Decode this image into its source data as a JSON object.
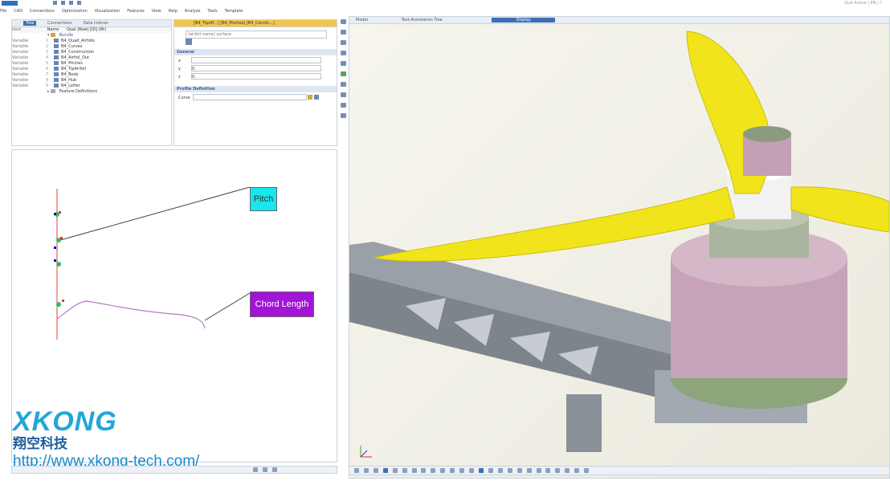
{
  "window": {
    "title_right": "Quit Active | EN | ?"
  },
  "menu": [
    "File",
    "CAD",
    "Connections",
    "Optimization",
    "Visualization",
    "Features",
    "View",
    "Help",
    "Analyze",
    "Tools",
    "Template"
  ],
  "left_tabs": [
    "Tree",
    "Connections",
    "Data Indices"
  ],
  "tree": {
    "header_cols": [
      "Item",
      "Name",
      "Qual (Row) [ID] (Rt)"
    ],
    "root": "Bundle",
    "items": [
      {
        "type": "Variable",
        "num": "1",
        "label": "B4_Quad_Airfoils"
      },
      {
        "type": "Variable",
        "num": "2",
        "label": "B4_Curves"
      },
      {
        "type": "Variable",
        "num": "3",
        "label": "B4_Construction"
      },
      {
        "type": "Variable",
        "num": "4",
        "label": "B4_Airfoil_Out"
      },
      {
        "type": "Variable",
        "num": "5",
        "label": "B4_Pitches"
      },
      {
        "type": "Variable",
        "num": "6",
        "label": "B4_TipAirfoil"
      },
      {
        "type": "Variable",
        "num": "7",
        "label": "B4_Body"
      },
      {
        "type": "Variable",
        "num": "8",
        "label": "B4_Hub"
      },
      {
        "type": "Variable",
        "num": "9",
        "label": "B4_Lofter"
      }
    ],
    "footer_item": "Feature Definitions"
  },
  "props": {
    "tab_title": "[B4_Tipoff...]   [B4_Pitches]   [B4_ConcIn...]",
    "search_placeholder": "(airfoil name) surface",
    "section_general": "General",
    "fields": [
      {
        "label": "x",
        "value": ""
      },
      {
        "label": "y",
        "value": "0"
      },
      {
        "label": "z",
        "value": "0"
      }
    ],
    "section_profile": "Profile Definition",
    "profile_label": "Curve"
  },
  "sketch": {
    "label_pitch": "Pitch",
    "label_chord": "Chord Length"
  },
  "viewport": {
    "tabs": [
      "Model",
      "Text-Annotation Tree",
      "Display"
    ]
  },
  "watermark": {
    "logo": "XKONG",
    "subtitle": "翔空科技",
    "url": "http://www.xkong-tech.com/"
  },
  "colors": {
    "pitch_fill": "#19e6ee",
    "chord_fill": "#a214d6",
    "blade": "#f2e41a",
    "motor": "#c6a3b8",
    "arm": "#8e949b",
    "logo": "#22a6d6"
  }
}
